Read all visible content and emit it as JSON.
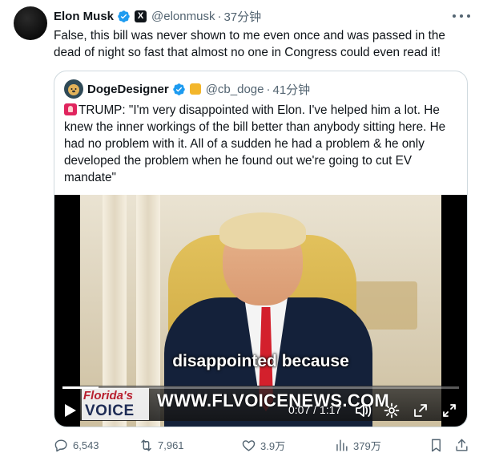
{
  "tweet": {
    "author_name": "Elon Musk",
    "handle": "@elonmusk",
    "separator": "·",
    "time": "37分钟",
    "text": "False, this bill was never shown to me even once and was passed in the dead of night so fast that almost no one in Congress could even read it!",
    "affiliation_label": "X"
  },
  "quote": {
    "author_name": "DogeDesigner",
    "handle": "@cb_doge",
    "separator": "·",
    "time": "41分钟",
    "text": "TRUMP: \"I'm very disappointed with Elon. I've helped him a lot. He knew the inner workings of the bill better than anybody sitting here. He had no problem with it. All of a sudden he had a problem & he only developed the problem when he found out we're going to cut EV mandate\"",
    "video": {
      "subtitle": "disappointed because",
      "logo_line1": "Florida's",
      "logo_line2": "VOICE",
      "watermark_url": "WWW.FLVOICENEWS.COM",
      "time_display": "0:07 / 1:17",
      "progress_fraction": 0.09
    }
  },
  "actions": {
    "replies": "6,543",
    "retweets": "7,961",
    "likes": "3.9万",
    "views": "379万"
  },
  "colors": {
    "verified_blue": "#1d9bf0",
    "muted_text": "#536471",
    "border": "#cfd9de",
    "alert_red": "#e0245e"
  },
  "icons": [
    "verified-badge-icon",
    "x-logo-icon",
    "more-icon",
    "alarm-icon",
    "play-icon",
    "volume-icon",
    "settings-icon",
    "pip-icon",
    "fullscreen-icon",
    "reply-icon",
    "retweet-icon",
    "like-icon",
    "views-icon",
    "bookmark-icon",
    "share-icon"
  ]
}
